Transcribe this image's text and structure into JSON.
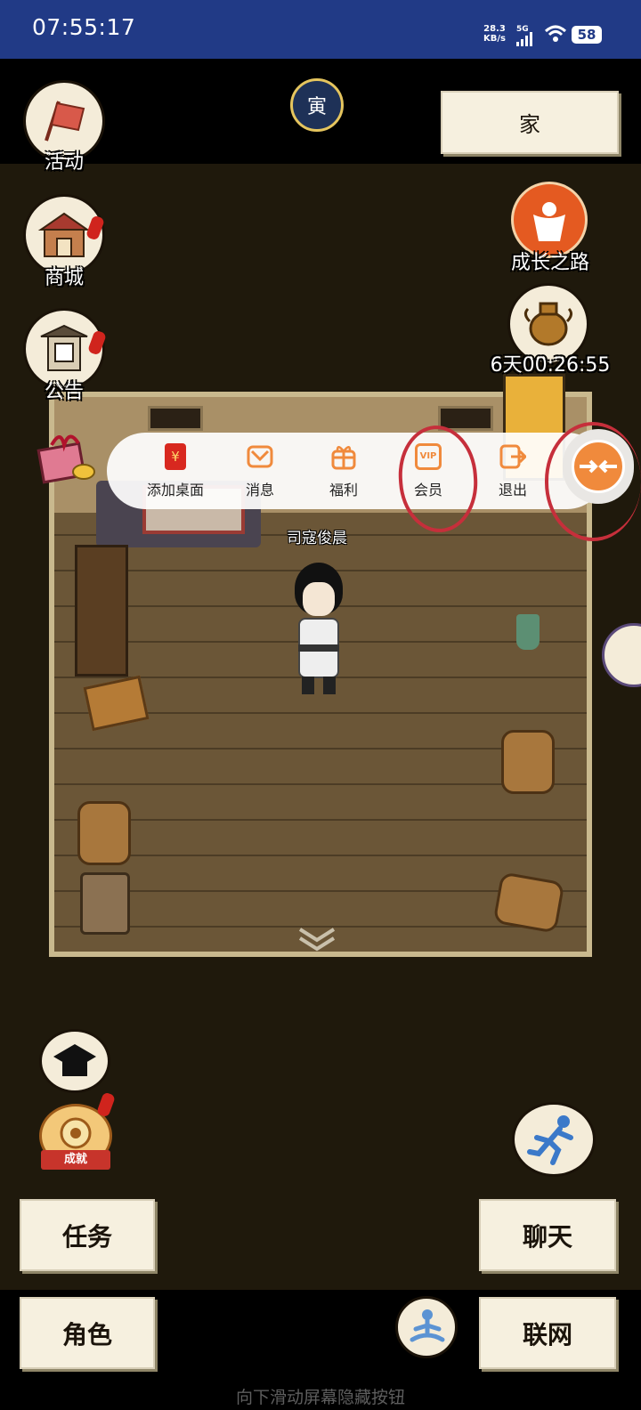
{
  "status_bar": {
    "time": "07:55:17",
    "net_speed_value": "28.3",
    "net_speed_unit": "KB/s",
    "network_type": "5G",
    "battery": "58"
  },
  "top": {
    "home_button": "家",
    "season_icon_char": "寅"
  },
  "left_menu": {
    "activity": "活动",
    "shop": "商城",
    "announcement": "公告"
  },
  "right_menu": {
    "growth_path": "成长之路",
    "countdown": "6天00:26:55"
  },
  "floating_menu": {
    "items": [
      {
        "label": "添加桌面",
        "icon": "red-envelope-icon"
      },
      {
        "label": "消息",
        "icon": "mail-icon"
      },
      {
        "label": "福利",
        "icon": "gift-icon"
      },
      {
        "label": "会员",
        "icon": "vip-icon",
        "icon_text": "VIP"
      },
      {
        "label": "退出",
        "icon": "exit-icon"
      }
    ]
  },
  "scene": {
    "player_name": "司寇俊晨"
  },
  "achievement_label": "成就",
  "bottom_buttons": {
    "task": "任务",
    "chat": "聊天",
    "role": "角色",
    "network": "联网"
  },
  "hint": "向下滑动屏幕隐藏按钮",
  "colors": {
    "status_bar": "#213a86",
    "scene_background": "#1f190c",
    "button_cream": "#f6f0df",
    "menu_orange": "#f08a3c",
    "annotation_red": "#c62f3b"
  }
}
